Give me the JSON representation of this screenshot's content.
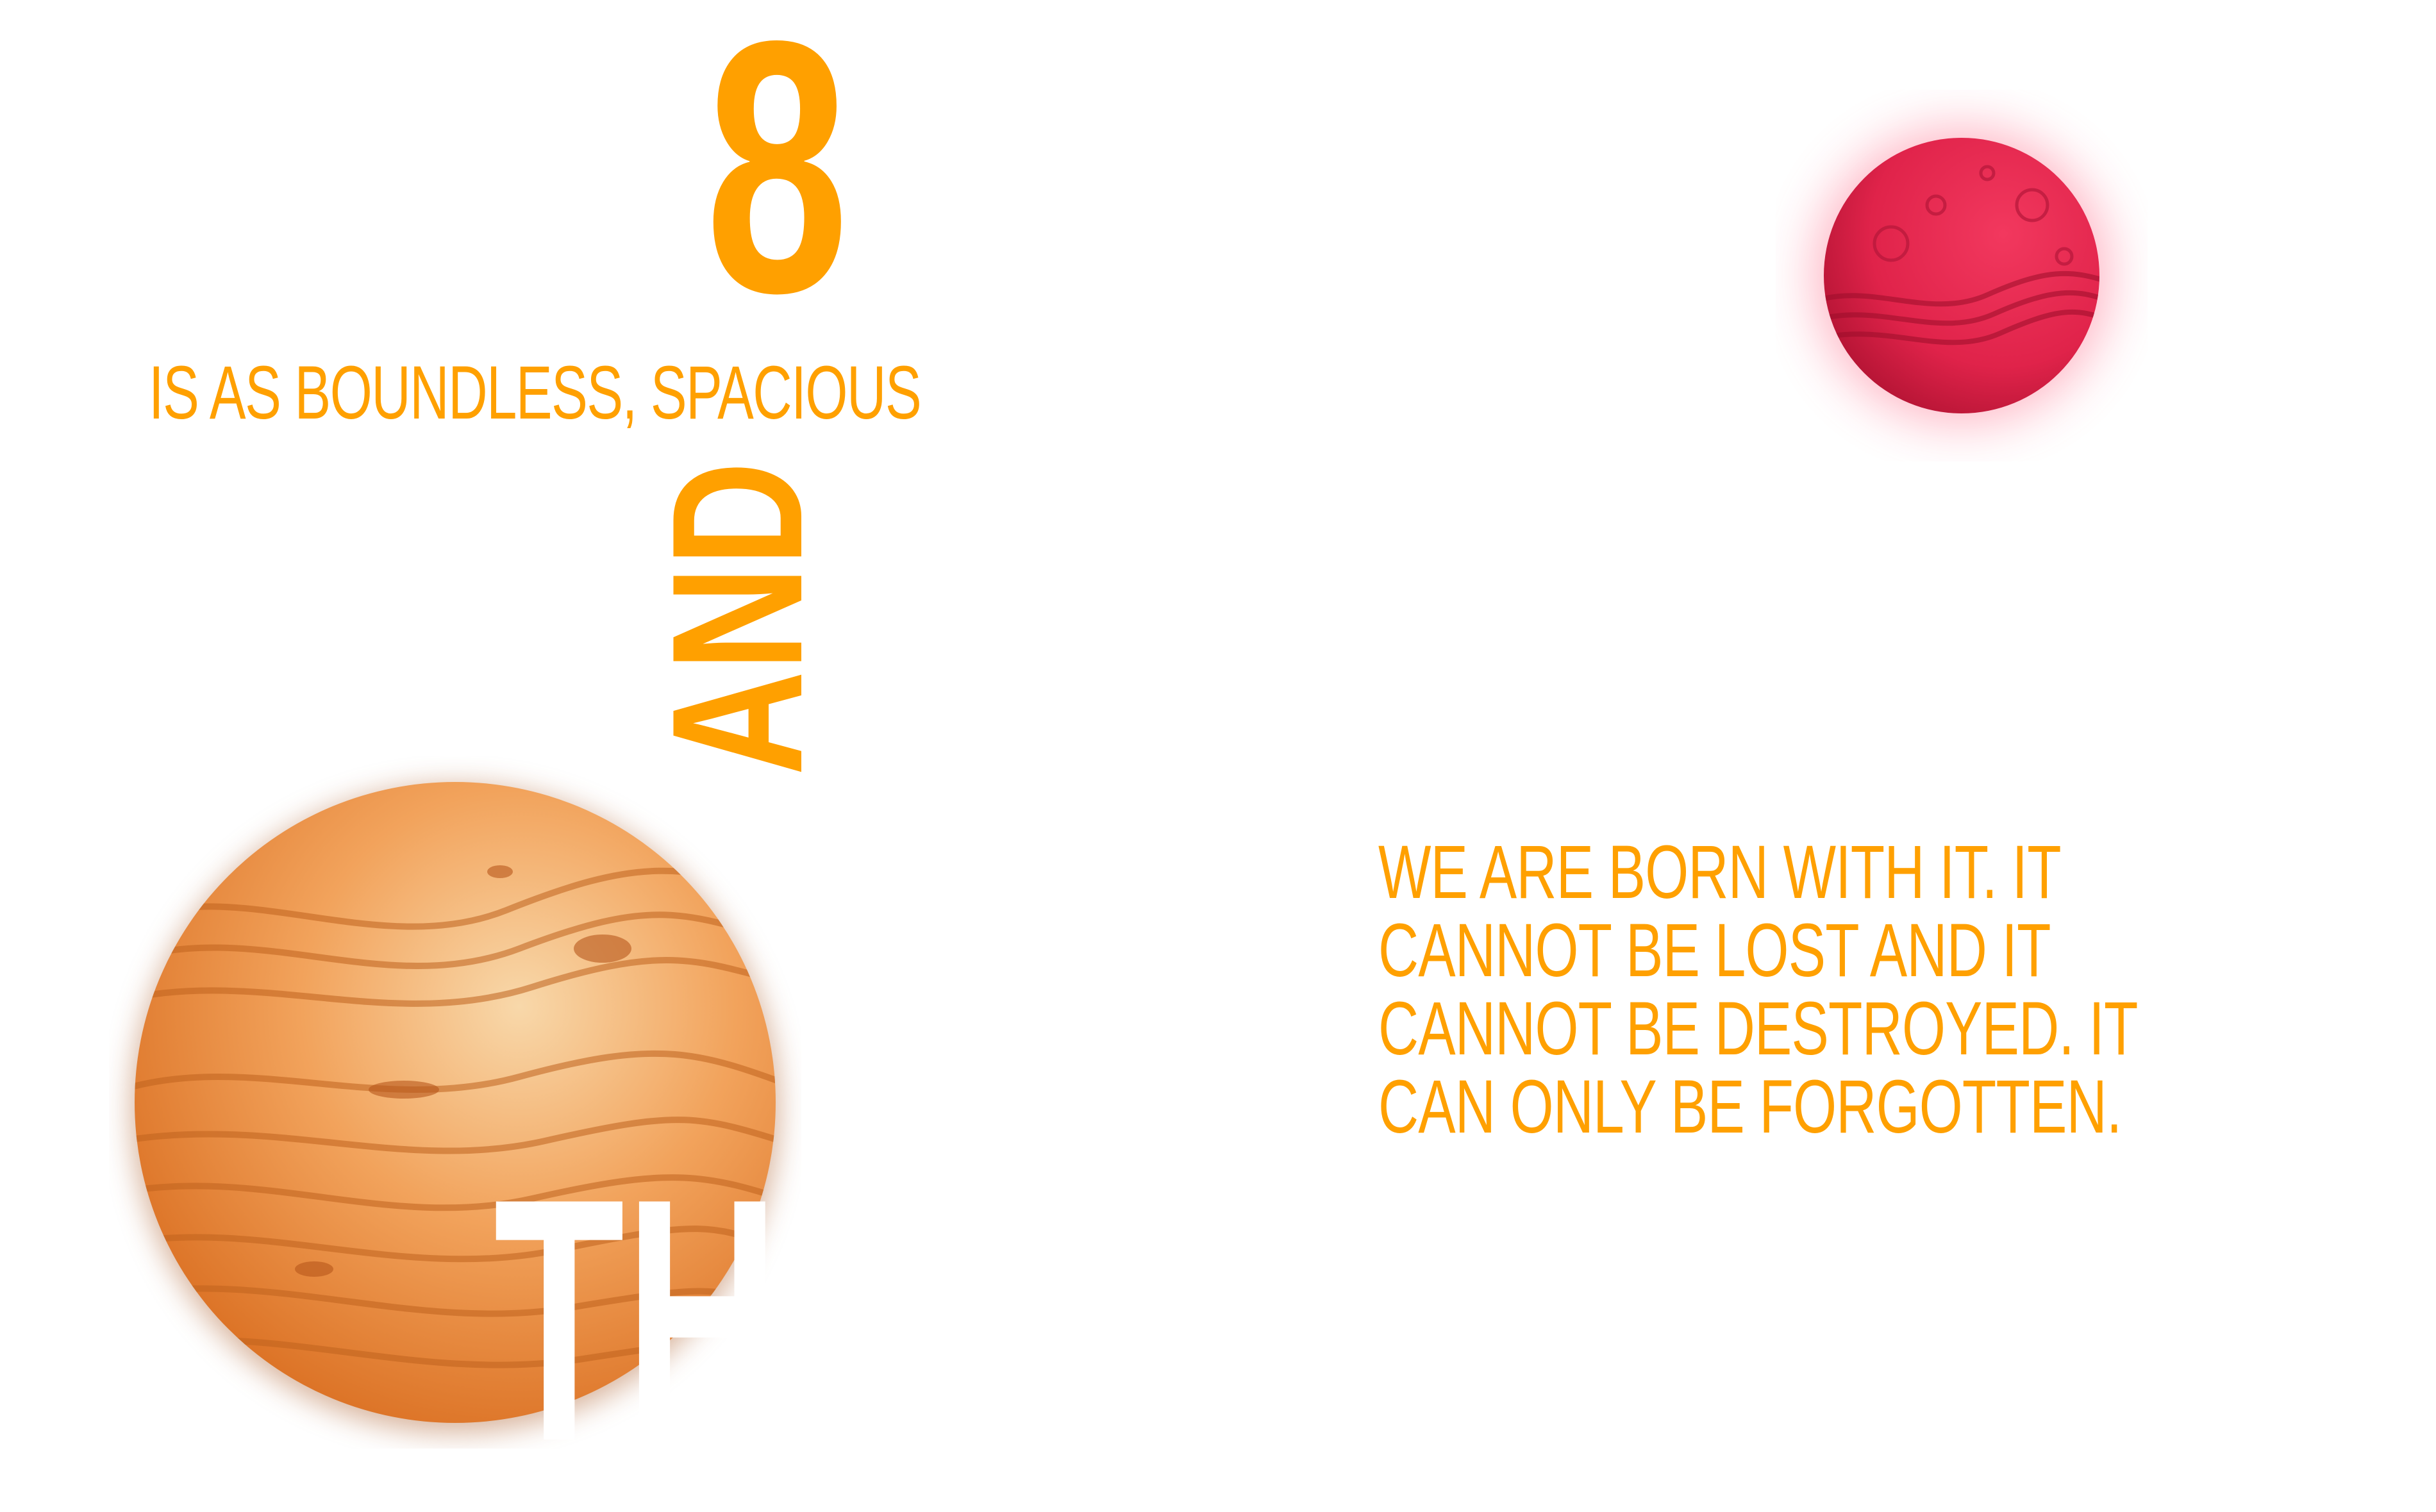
{
  "headline": {
    "number": "8",
    "subtitle": "IS AS BOUNDLESS, SPACIOUS",
    "vertical_word": "AND",
    "big_white_word": "TH"
  },
  "quote": {
    "text": "WE ARE BORN WITH IT. IT CANNOT BE LOST AND IT CANNOT BE DESTROYED. IT CAN ONLY BE FORGOTTEN."
  },
  "colors": {
    "accent": "#ffa000",
    "background": "#ffffff",
    "red_planet": "#e8254e",
    "orange_planet": "#f0a25a"
  },
  "icons": {
    "orange_planet": "orange-planet-illustration",
    "red_planet": "red-planet-illustration"
  }
}
